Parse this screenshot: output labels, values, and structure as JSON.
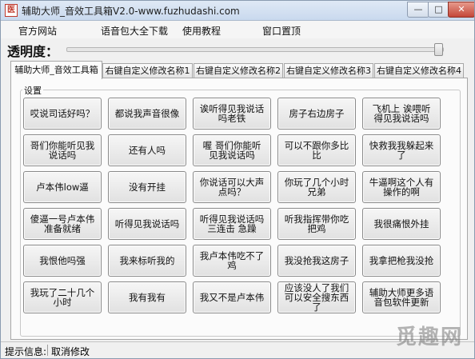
{
  "window": {
    "title": "辅助大师_音效工具箱V2.0-www.fuzhudashi.com",
    "icon_glyph": "医",
    "minimize_glyph": "—",
    "maximize_glyph": "□",
    "close_glyph": "✕"
  },
  "menu": [
    {
      "label": "官方网站"
    },
    {
      "label": "语音包大全下载"
    },
    {
      "label": "使用教程"
    },
    {
      "label": "窗口置顶"
    }
  ],
  "transparency": {
    "label": "透明度：",
    "level": 1.0
  },
  "tabs": [
    {
      "label": "辅助大师_音效工具箱",
      "active": true
    },
    {
      "label": "右键自定义修改名称1",
      "active": false
    },
    {
      "label": "右键自定义修改名称2",
      "active": false
    },
    {
      "label": "右键自定义修改名称3",
      "active": false
    },
    {
      "label": "右键自定义修改名称4",
      "active": false
    }
  ],
  "settings": {
    "group_title": "设置",
    "buttons": [
      "哎说司话好吗？",
      "都说我声音很像",
      "诶听得见我说话吗老铁",
      "房子右边房子",
      "飞机上 诶喂听得见我说话吗",
      "哥们你能听见我说话吗",
      "还有人吗",
      "喔 哥们你能听见我说话吗",
      "可以不跟你多比比",
      "快救我我躲起来了",
      "卢本伟low逼",
      "没有开挂",
      "你说话可以大声点吗？",
      "你玩了几个小时兄弟",
      "牛逼啊这个人有操作的啊",
      "傻逼一号卢本伟准备就绪",
      "听得见我说话吗",
      "听得见我说话吗三连击 急躁",
      "听我指挥带你吃把鸡",
      "我很痛恨外挂",
      "我恨他吗强",
      "我来标听我的",
      "我卢本伟吃不了鸡",
      "我没抢我这房子",
      "我拿把枪我没抢",
      "我玩了二十几个小时",
      "我有我有",
      "我又不是卢本伟",
      "应该没人了我们可以安全搜东西了",
      "辅助大师更多语音包软件更新"
    ]
  },
  "status": {
    "label": "提示信息:",
    "value": "取消修改"
  },
  "watermark": "觅趣网"
}
